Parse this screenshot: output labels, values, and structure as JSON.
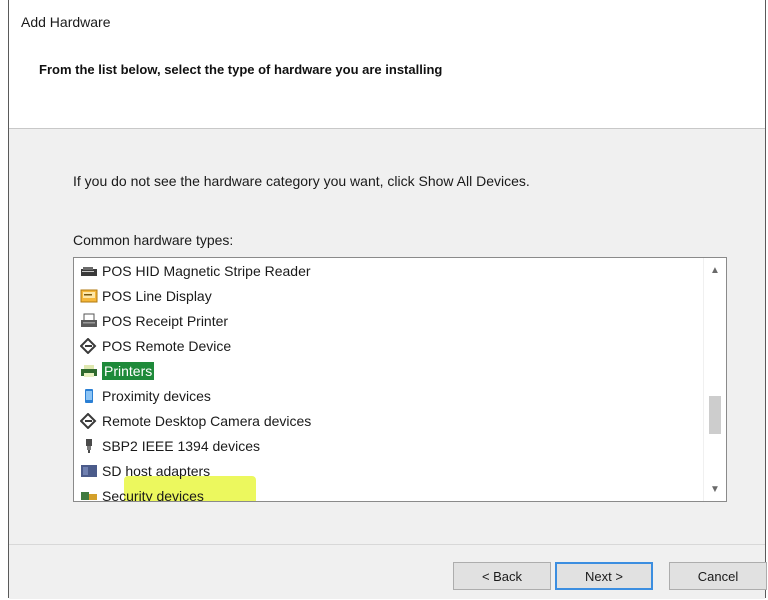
{
  "window": {
    "title": "Add Hardware"
  },
  "header": {
    "text": "From the list below, select the type of hardware you are installing"
  },
  "main": {
    "instruction": "If you do not see the hardware category you want, click Show All Devices.",
    "list_label": "Common hardware types:",
    "items": [
      {
        "label": "POS HID Magnetic Stripe Reader",
        "icon": "magnetic-stripe-reader-icon"
      },
      {
        "label": "POS Line Display",
        "icon": "line-display-icon"
      },
      {
        "label": "POS Receipt Printer",
        "icon": "receipt-printer-icon"
      },
      {
        "label": "POS Remote Device",
        "icon": "remote-device-icon"
      },
      {
        "label": "Printers",
        "icon": "printer-icon",
        "selected": true
      },
      {
        "label": "Proximity devices",
        "icon": "proximity-device-icon"
      },
      {
        "label": "Remote Desktop Camera devices",
        "icon": "remote-camera-icon"
      },
      {
        "label": "SBP2 IEEE 1394 devices",
        "icon": "ieee1394-icon"
      },
      {
        "label": "SD host adapters",
        "icon": "sd-adapter-icon"
      },
      {
        "label": "Security devices",
        "icon": "security-device-icon"
      }
    ]
  },
  "footer": {
    "back_label": "< Back",
    "next_label": "Next >",
    "cancel_label": "Cancel"
  },
  "colors": {
    "selection": "#1e8a3a",
    "highlighter": "#e6f528",
    "default_button_border": "#3c8ee0"
  }
}
